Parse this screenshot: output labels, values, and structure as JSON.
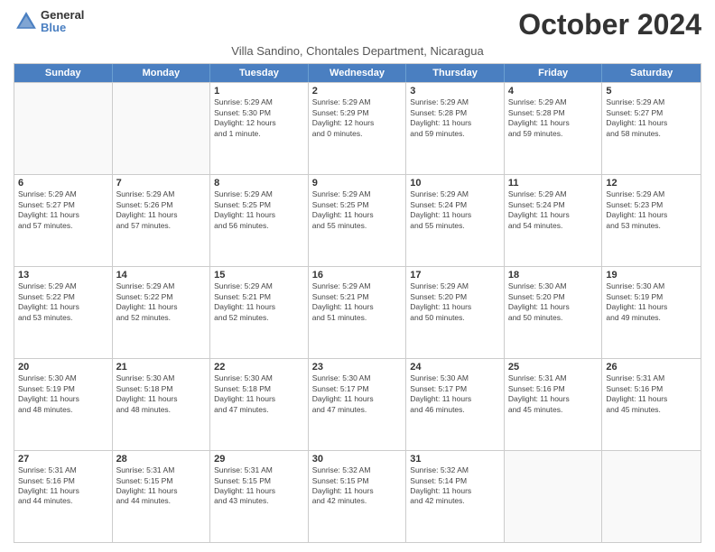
{
  "logo": {
    "general": "General",
    "blue": "Blue"
  },
  "title": "October 2024",
  "subtitle": "Villa Sandino, Chontales Department, Nicaragua",
  "days": [
    "Sunday",
    "Monday",
    "Tuesday",
    "Wednesday",
    "Thursday",
    "Friday",
    "Saturday"
  ],
  "rows": [
    [
      {
        "day": "",
        "text": "",
        "empty": true
      },
      {
        "day": "",
        "text": "",
        "empty": true
      },
      {
        "day": "1",
        "text": "Sunrise: 5:29 AM\nSunset: 5:30 PM\nDaylight: 12 hours\nand 1 minute."
      },
      {
        "day": "2",
        "text": "Sunrise: 5:29 AM\nSunset: 5:29 PM\nDaylight: 12 hours\nand 0 minutes."
      },
      {
        "day": "3",
        "text": "Sunrise: 5:29 AM\nSunset: 5:28 PM\nDaylight: 11 hours\nand 59 minutes."
      },
      {
        "day": "4",
        "text": "Sunrise: 5:29 AM\nSunset: 5:28 PM\nDaylight: 11 hours\nand 59 minutes."
      },
      {
        "day": "5",
        "text": "Sunrise: 5:29 AM\nSunset: 5:27 PM\nDaylight: 11 hours\nand 58 minutes."
      }
    ],
    [
      {
        "day": "6",
        "text": "Sunrise: 5:29 AM\nSunset: 5:27 PM\nDaylight: 11 hours\nand 57 minutes."
      },
      {
        "day": "7",
        "text": "Sunrise: 5:29 AM\nSunset: 5:26 PM\nDaylight: 11 hours\nand 57 minutes."
      },
      {
        "day": "8",
        "text": "Sunrise: 5:29 AM\nSunset: 5:25 PM\nDaylight: 11 hours\nand 56 minutes."
      },
      {
        "day": "9",
        "text": "Sunrise: 5:29 AM\nSunset: 5:25 PM\nDaylight: 11 hours\nand 55 minutes."
      },
      {
        "day": "10",
        "text": "Sunrise: 5:29 AM\nSunset: 5:24 PM\nDaylight: 11 hours\nand 55 minutes."
      },
      {
        "day": "11",
        "text": "Sunrise: 5:29 AM\nSunset: 5:24 PM\nDaylight: 11 hours\nand 54 minutes."
      },
      {
        "day": "12",
        "text": "Sunrise: 5:29 AM\nSunset: 5:23 PM\nDaylight: 11 hours\nand 53 minutes."
      }
    ],
    [
      {
        "day": "13",
        "text": "Sunrise: 5:29 AM\nSunset: 5:22 PM\nDaylight: 11 hours\nand 53 minutes."
      },
      {
        "day": "14",
        "text": "Sunrise: 5:29 AM\nSunset: 5:22 PM\nDaylight: 11 hours\nand 52 minutes."
      },
      {
        "day": "15",
        "text": "Sunrise: 5:29 AM\nSunset: 5:21 PM\nDaylight: 11 hours\nand 52 minutes."
      },
      {
        "day": "16",
        "text": "Sunrise: 5:29 AM\nSunset: 5:21 PM\nDaylight: 11 hours\nand 51 minutes."
      },
      {
        "day": "17",
        "text": "Sunrise: 5:29 AM\nSunset: 5:20 PM\nDaylight: 11 hours\nand 50 minutes."
      },
      {
        "day": "18",
        "text": "Sunrise: 5:30 AM\nSunset: 5:20 PM\nDaylight: 11 hours\nand 50 minutes."
      },
      {
        "day": "19",
        "text": "Sunrise: 5:30 AM\nSunset: 5:19 PM\nDaylight: 11 hours\nand 49 minutes."
      }
    ],
    [
      {
        "day": "20",
        "text": "Sunrise: 5:30 AM\nSunset: 5:19 PM\nDaylight: 11 hours\nand 48 minutes."
      },
      {
        "day": "21",
        "text": "Sunrise: 5:30 AM\nSunset: 5:18 PM\nDaylight: 11 hours\nand 48 minutes."
      },
      {
        "day": "22",
        "text": "Sunrise: 5:30 AM\nSunset: 5:18 PM\nDaylight: 11 hours\nand 47 minutes."
      },
      {
        "day": "23",
        "text": "Sunrise: 5:30 AM\nSunset: 5:17 PM\nDaylight: 11 hours\nand 47 minutes."
      },
      {
        "day": "24",
        "text": "Sunrise: 5:30 AM\nSunset: 5:17 PM\nDaylight: 11 hours\nand 46 minutes."
      },
      {
        "day": "25",
        "text": "Sunrise: 5:31 AM\nSunset: 5:16 PM\nDaylight: 11 hours\nand 45 minutes."
      },
      {
        "day": "26",
        "text": "Sunrise: 5:31 AM\nSunset: 5:16 PM\nDaylight: 11 hours\nand 45 minutes."
      }
    ],
    [
      {
        "day": "27",
        "text": "Sunrise: 5:31 AM\nSunset: 5:16 PM\nDaylight: 11 hours\nand 44 minutes."
      },
      {
        "day": "28",
        "text": "Sunrise: 5:31 AM\nSunset: 5:15 PM\nDaylight: 11 hours\nand 44 minutes."
      },
      {
        "day": "29",
        "text": "Sunrise: 5:31 AM\nSunset: 5:15 PM\nDaylight: 11 hours\nand 43 minutes."
      },
      {
        "day": "30",
        "text": "Sunrise: 5:32 AM\nSunset: 5:15 PM\nDaylight: 11 hours\nand 42 minutes."
      },
      {
        "day": "31",
        "text": "Sunrise: 5:32 AM\nSunset: 5:14 PM\nDaylight: 11 hours\nand 42 minutes."
      },
      {
        "day": "",
        "text": "",
        "empty": true
      },
      {
        "day": "",
        "text": "",
        "empty": true
      }
    ]
  ]
}
